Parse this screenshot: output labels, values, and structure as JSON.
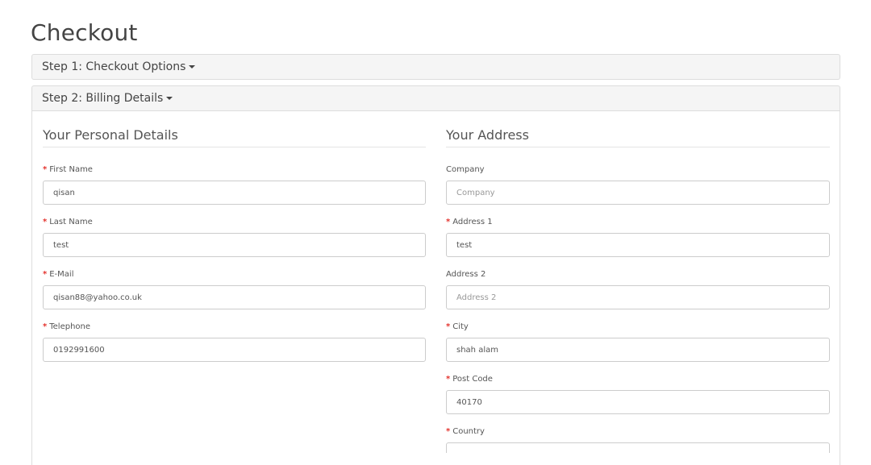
{
  "page": {
    "title": "Checkout"
  },
  "steps": [
    {
      "label": "Step 1: Checkout Options"
    },
    {
      "label": "Step 2: Billing Details"
    }
  ],
  "personal": {
    "legend": "Your Personal Details",
    "fields": {
      "firstname": {
        "label": "First Name",
        "required": true,
        "value": "qisan",
        "placeholder": ""
      },
      "lastname": {
        "label": "Last Name",
        "required": true,
        "value": "test",
        "placeholder": ""
      },
      "email": {
        "label": "E-Mail",
        "required": true,
        "value": "qisan88@yahoo.co.uk",
        "placeholder": ""
      },
      "telephone": {
        "label": "Telephone",
        "required": true,
        "value": "0192991600",
        "placeholder": ""
      }
    }
  },
  "address": {
    "legend": "Your Address",
    "fields": {
      "company": {
        "label": "Company",
        "required": false,
        "value": "",
        "placeholder": "Company"
      },
      "address1": {
        "label": "Address 1",
        "required": true,
        "value": "test",
        "placeholder": ""
      },
      "address2": {
        "label": "Address 2",
        "required": false,
        "value": "",
        "placeholder": "Address 2"
      },
      "city": {
        "label": "City",
        "required": true,
        "value": "shah alam",
        "placeholder": ""
      },
      "postcode": {
        "label": "Post Code",
        "required": true,
        "value": "40170",
        "placeholder": ""
      },
      "country": {
        "label": "Country",
        "required": true,
        "value": "",
        "placeholder": ""
      }
    }
  },
  "required_marker": "*",
  "colors": {
    "required": "#e4332e",
    "panel_heading_bg": "#f5f5f5",
    "border": "#dddddd"
  }
}
